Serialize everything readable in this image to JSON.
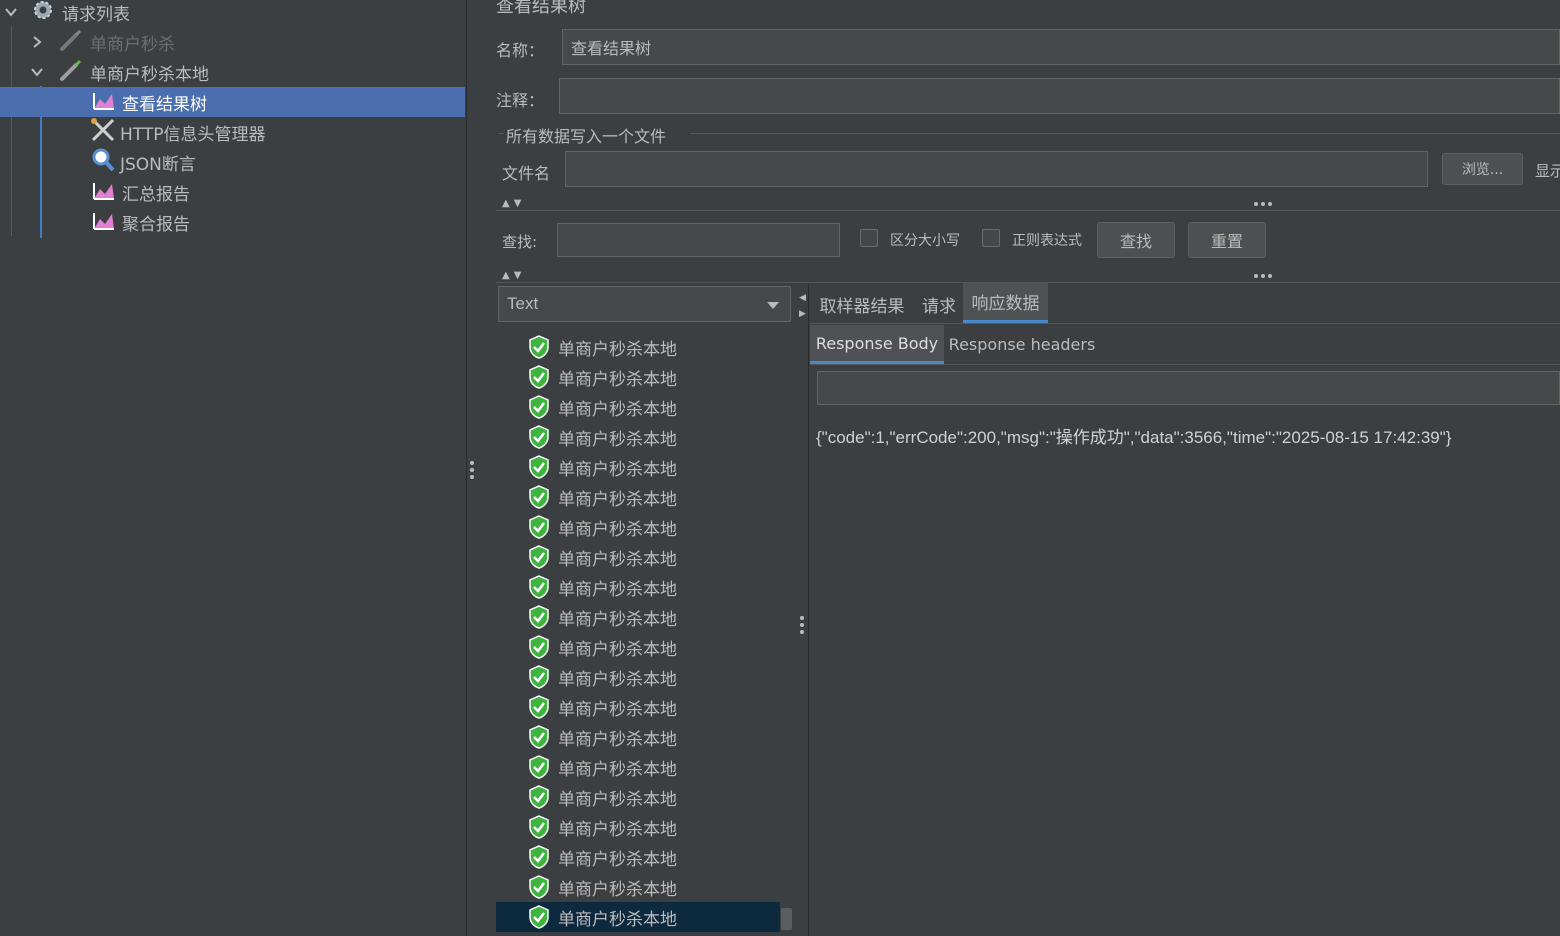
{
  "tree": {
    "root_label": "请求列表",
    "items": [
      {
        "label": "单商户秒杀",
        "disabled": true
      },
      {
        "label": "单商户秒杀本地",
        "disabled": false
      },
      {
        "label": "查看结果树",
        "selected": true
      },
      {
        "label": "HTTP信息头管理器"
      },
      {
        "label": "JSON断言"
      },
      {
        "label": "汇总报告"
      },
      {
        "label": "聚合报告"
      }
    ]
  },
  "panel": {
    "title": "查看结果树",
    "name_label": "名称：",
    "name_value": "查看结果树",
    "comment_label": "注释：",
    "comment_value": "",
    "file_section_label": "所有数据写入一个文件",
    "filename_label": "文件名",
    "filename_value": "",
    "browse_label": "浏览...",
    "display_label": "显示",
    "search_label": "查找:",
    "search_value": "",
    "case_label": "区分大小写",
    "regex_label": "正则表达式",
    "find_button": "查找",
    "reset_button": "重置"
  },
  "renderer": {
    "selected": "Text"
  },
  "results": {
    "item_label": "单商户秒杀本地",
    "count": 20
  },
  "tabs": {
    "sampler_result": "取样器结果",
    "request": "请求",
    "response_data": "响应数据"
  },
  "subtabs": {
    "body": "Response Body",
    "headers": "Response headers"
  },
  "response": {
    "text": "{\"code\":1,\"errCode\":200,\"msg\":\"操作成功\",\"data\":3566,\"time\":\"2025-08-15 17:42:39\"}"
  },
  "colors": {
    "background": "#3c3f41",
    "selection": "#4b6eaf",
    "success": "#3fb33f"
  }
}
